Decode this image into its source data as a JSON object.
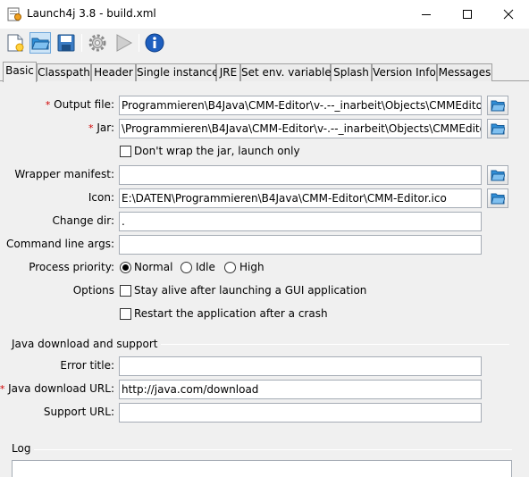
{
  "window": {
    "title": "Launch4j 3.8 - build.xml"
  },
  "toolbar": {
    "buttons": [
      {
        "name": "new-config",
        "icon": "new-file-icon"
      },
      {
        "name": "open-config",
        "icon": "open-folder-icon"
      },
      {
        "name": "save-config",
        "icon": "save-disk-icon"
      },
      {
        "name": "build-wrapper",
        "icon": "gear-icon"
      },
      {
        "name": "test-wrapper",
        "icon": "play-icon"
      },
      {
        "name": "about",
        "icon": "info-icon"
      }
    ]
  },
  "tabs": [
    "Basic",
    "Classpath",
    "Header",
    "Single instance",
    "JRE",
    "Set env. variables",
    "Splash",
    "Version Info",
    "Messages"
  ],
  "basic": {
    "required_marker": "*",
    "output_file": {
      "label": "Output file:",
      "value": "Programmieren\\B4Java\\CMM-Editor\\v-.--_inarbeit\\Objects\\CMMEditor.exe"
    },
    "jar": {
      "label": "Jar:",
      "value": "\\Programmieren\\B4Java\\CMM-Editor\\v-.--_inarbeit\\Objects\\CMMEditor.jar"
    },
    "dont_wrap": {
      "label": "Don't wrap the jar, launch only",
      "checked": false
    },
    "wrapper_manifest": {
      "label": "Wrapper manifest:",
      "value": ""
    },
    "icon": {
      "label": "Icon:",
      "value": "E:\\DATEN\\Programmieren\\B4Java\\CMM-Editor\\CMM-Editor.ico"
    },
    "change_dir": {
      "label": "Change dir:",
      "value": "."
    },
    "cmd_args": {
      "label": "Command line args:",
      "value": ""
    },
    "priority": {
      "label": "Process priority:",
      "options": [
        "Normal",
        "Idle",
        "High"
      ],
      "selected": "Normal"
    },
    "options": {
      "label": "Options",
      "stay_alive": {
        "label": "Stay alive after launching a GUI application",
        "checked": false
      },
      "restart": {
        "label": "Restart the application after a crash",
        "checked": false
      }
    }
  },
  "java_download": {
    "title": "Java download and support",
    "error_title": {
      "label": "Error title:",
      "value": ""
    },
    "download_url": {
      "label": "Java download URL:",
      "value": "http://java.com/download"
    },
    "support_url": {
      "label": "Support URL:",
      "value": ""
    }
  },
  "log": {
    "title": "Log"
  },
  "colors": {
    "required": "#d00000",
    "folder": "#2f8fd8",
    "info": "#1e5fbf"
  }
}
